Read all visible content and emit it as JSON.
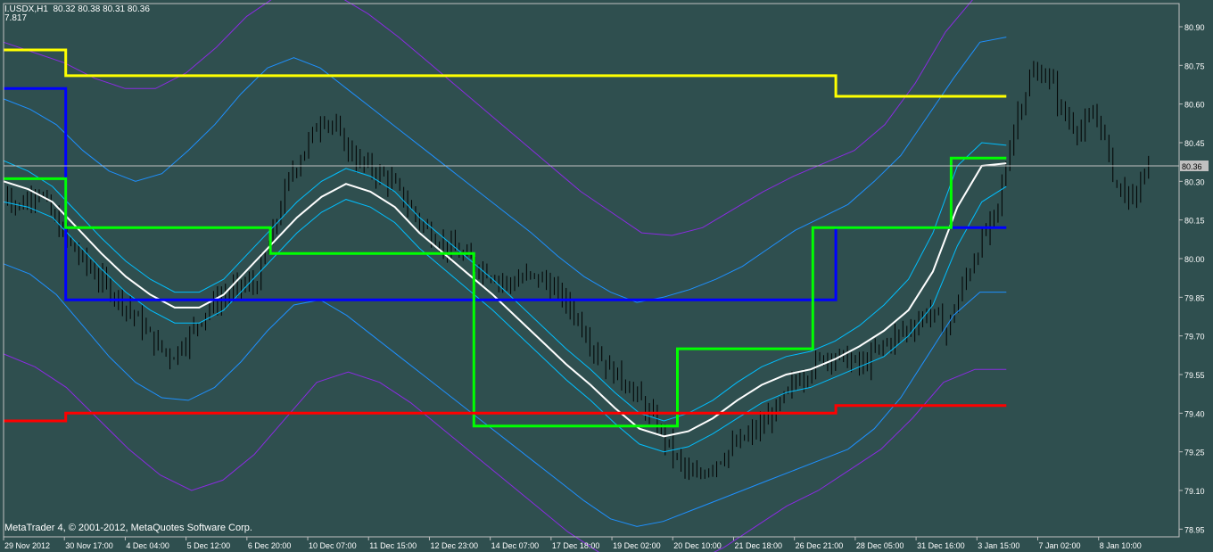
{
  "header": {
    "symbol_line": "I.USDX,H1  80.32 80.38 80.31 80.36",
    "indicator_value": "7.817"
  },
  "footer": {
    "copyright": "MetaTrader 4, © 2001-2012, MetaQuotes Software Corp."
  },
  "colors": {
    "background": "#2f4f4f",
    "axis": "#c0c0c0",
    "candles": "#000000",
    "current_price_line": "#c0c0c0",
    "yellow": "#ffff00",
    "blue": "#0000ff",
    "green": "#00ff00",
    "red": "#ff0000",
    "white": "#ffffff",
    "cyan_band": "#00bfff",
    "blue_band": "#1e90ff",
    "purple_band": "#8a2be2"
  },
  "chart_data": {
    "type": "line",
    "ylim": [
      78.92,
      80.99
    ],
    "yticks": [
      "80.90",
      "80.75",
      "80.60",
      "80.45",
      "80.30",
      "80.15",
      "80.00",
      "79.85",
      "79.70",
      "79.55",
      "79.40",
      "79.25",
      "79.10",
      "78.95"
    ],
    "xticks": [
      "29 Nov 2012",
      "30 Nov 17:00",
      "4 Dec 04:00",
      "5 Dec 12:00",
      "6 Dec 20:00",
      "10 Dec 07:00",
      "11 Dec 15:00",
      "12 Dec 23:00",
      "14 Dec 07:00",
      "17 Dec 18:00",
      "19 Dec 02:00",
      "20 Dec 10:00",
      "21 Dec 18:00",
      "26 Dec 21:00",
      "28 Dec 05:00",
      "31 Dec 16:00",
      "3 Jan 15:00",
      "7 Jan 02:00",
      "8 Jan 10:00"
    ],
    "current_price": 80.36,
    "current_price_label": "80.36",
    "close": [
      80.26,
      80.2,
      80.28,
      80.15,
      80.05,
      79.97,
      79.9,
      79.84,
      79.76,
      79.67,
      79.62,
      79.7,
      79.8,
      79.85,
      79.89,
      79.9,
      80.1,
      80.32,
      80.44,
      80.56,
      80.47,
      80.38,
      80.34,
      80.3,
      80.21,
      80.12,
      80.06,
      80.02,
      79.98,
      79.94,
      79.9,
      79.93,
      79.92,
      79.86,
      79.78,
      79.66,
      79.57,
      79.52,
      79.43,
      79.33,
      79.22,
      79.14,
      79.2,
      79.25,
      79.3,
      79.35,
      79.42,
      79.52,
      79.58,
      79.63,
      79.61,
      79.58,
      79.65,
      79.7,
      79.74,
      79.8,
      79.72,
      79.9,
      80.06,
      80.18,
      80.52,
      80.71,
      80.72,
      80.55,
      80.5,
      80.56,
      80.3,
      80.22,
      80.36
    ],
    "series": [
      {
        "name": "",
        "role": "white_ma",
        "values": [
          80.3,
          80.27,
          80.22,
          80.12,
          80.02,
          79.93,
          79.86,
          79.81,
          79.81,
          79.86,
          79.96,
          80.06,
          80.16,
          80.24,
          80.29,
          80.26,
          80.2,
          80.1,
          80.02,
          79.94,
          79.86,
          79.77,
          79.68,
          79.59,
          79.51,
          79.42,
          79.34,
          79.31,
          79.33,
          79.38,
          79.45,
          79.51,
          79.55,
          79.57,
          79.61,
          79.66,
          79.72,
          79.8,
          79.95,
          80.2,
          80.36,
          80.37
        ]
      },
      {
        "name": "",
        "role": "cyan_upper",
        "values": [
          80.38,
          80.34,
          80.28,
          80.18,
          80.08,
          79.99,
          79.92,
          79.87,
          79.87,
          79.92,
          80.02,
          80.12,
          80.22,
          80.3,
          80.35,
          80.32,
          80.26,
          80.16,
          80.08,
          80.0,
          79.92,
          79.83,
          79.74,
          79.65,
          79.57,
          79.48,
          79.4,
          79.37,
          79.4,
          79.45,
          79.52,
          79.58,
          79.62,
          79.64,
          79.68,
          79.74,
          79.82,
          79.92,
          80.1,
          80.36,
          80.45,
          80.44
        ]
      },
      {
        "name": "",
        "role": "cyan_lower",
        "values": [
          80.22,
          80.2,
          80.16,
          80.06,
          79.96,
          79.87,
          79.8,
          79.75,
          79.75,
          79.8,
          79.9,
          80.0,
          80.1,
          80.18,
          80.23,
          80.2,
          80.14,
          80.04,
          79.96,
          79.88,
          79.8,
          79.71,
          79.62,
          79.53,
          79.45,
          79.36,
          79.28,
          79.25,
          79.27,
          79.32,
          79.38,
          79.44,
          79.48,
          79.5,
          79.54,
          79.58,
          79.62,
          79.7,
          79.82,
          80.05,
          80.22,
          80.28
        ]
      },
      {
        "name": "",
        "role": "blue_upper",
        "values": [
          80.62,
          80.58,
          80.52,
          80.42,
          80.34,
          80.3,
          80.33,
          80.42,
          80.52,
          80.64,
          80.74,
          80.78,
          80.74,
          80.66,
          80.58,
          80.5,
          80.42,
          80.34,
          80.26,
          80.18,
          80.1,
          80.01,
          79.93,
          79.87,
          79.83,
          79.85,
          79.88,
          79.92,
          79.97,
          80.04,
          80.11,
          80.16,
          80.21,
          80.3,
          80.4,
          80.55,
          80.7,
          80.84,
          80.86
        ]
      },
      {
        "name": "",
        "role": "blue_lower",
        "values": [
          79.98,
          79.94,
          79.86,
          79.74,
          79.62,
          79.52,
          79.46,
          79.45,
          79.5,
          79.6,
          79.72,
          79.82,
          79.84,
          79.78,
          79.7,
          79.62,
          79.54,
          79.46,
          79.38,
          79.3,
          79.22,
          79.14,
          79.06,
          78.99,
          78.96,
          78.98,
          79.02,
          79.06,
          79.1,
          79.14,
          79.18,
          79.22,
          79.26,
          79.34,
          79.46,
          79.62,
          79.78,
          79.87,
          79.87
        ]
      },
      {
        "name": "",
        "role": "purple_upper",
        "values": [
          80.84,
          80.8,
          80.76,
          80.7,
          80.66,
          80.66,
          80.72,
          80.82,
          80.94,
          81.02,
          81.06,
          81.02,
          80.95,
          80.86,
          80.76,
          80.66,
          80.56,
          80.46,
          80.36,
          80.26,
          80.18,
          80.1,
          80.09,
          80.12,
          80.19,
          80.26,
          80.32,
          80.37,
          80.42,
          80.52,
          80.68,
          80.88,
          81.02,
          81.02
        ]
      },
      {
        "name": "",
        "role": "purple_lower",
        "values": [
          79.63,
          79.58,
          79.5,
          79.38,
          79.26,
          79.16,
          79.1,
          79.14,
          79.24,
          79.38,
          79.52,
          79.56,
          79.52,
          79.44,
          79.34,
          79.24,
          79.14,
          79.04,
          78.94,
          78.86,
          78.8,
          78.78,
          78.82,
          78.88,
          78.96,
          79.04,
          79.1,
          79.18,
          79.26,
          79.38,
          79.52,
          79.57,
          79.57
        ]
      }
    ],
    "levels": {
      "yellow": [
        {
          "from": 0,
          "to": 0.062,
          "value": 80.81
        },
        {
          "from": 0.062,
          "to": 0.83,
          "value": 80.71
        },
        {
          "from": 0.83,
          "to": 1,
          "value": 80.63
        }
      ],
      "blue": [
        {
          "from": 0,
          "to": 0.062,
          "value": 80.66
        },
        {
          "from": 0.062,
          "to": 0.83,
          "value": 79.84
        },
        {
          "from": 0.83,
          "to": 1,
          "value": 80.12
        }
      ],
      "green": [
        {
          "from": 0,
          "to": 0.062,
          "value": 80.31
        },
        {
          "from": 0.062,
          "to": 0.266,
          "value": 80.12
        },
        {
          "from": 0.266,
          "to": 0.469,
          "value": 80.02
        },
        {
          "from": 0.469,
          "to": 0.672,
          "value": 79.35
        },
        {
          "from": 0.672,
          "to": 0.807,
          "value": 79.65
        },
        {
          "from": 0.807,
          "to": 0.945,
          "value": 80.12
        },
        {
          "from": 0.945,
          "to": 1,
          "value": 80.39
        }
      ],
      "red": [
        {
          "from": 0,
          "to": 0.062,
          "value": 79.37
        },
        {
          "from": 0.062,
          "to": 0.83,
          "value": 79.4
        },
        {
          "from": 0.83,
          "to": 1,
          "value": 79.43
        }
      ]
    }
  }
}
